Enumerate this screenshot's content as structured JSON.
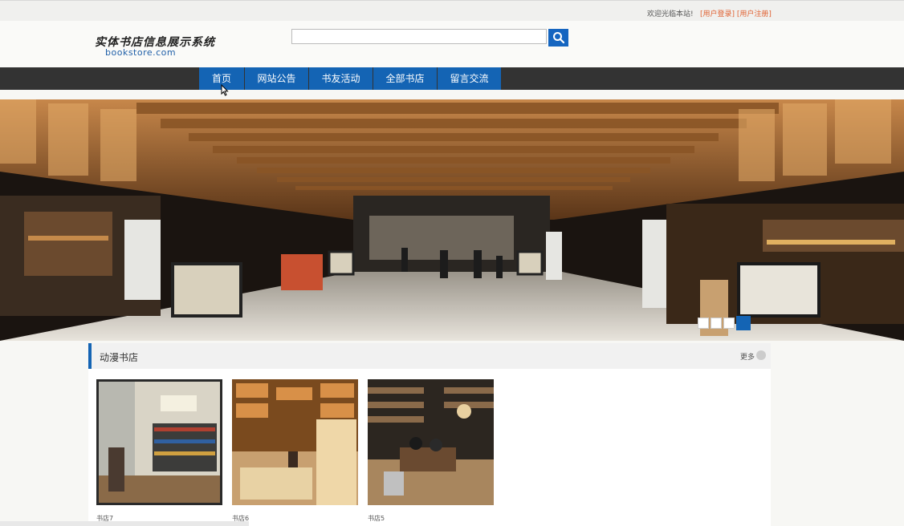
{
  "topbar": {
    "welcome": "欢迎光临本站!",
    "login_link": "[用户登录]",
    "register_link": "[用户注册]"
  },
  "header": {
    "logo_title": "实体书店信息展示系统",
    "logo_domain": "bookstore.com",
    "search": {
      "value": "",
      "placeholder": ""
    },
    "search_icon": "search-icon"
  },
  "nav": {
    "items": [
      {
        "label": "首页"
      },
      {
        "label": "网站公告"
      },
      {
        "label": "书友活动"
      },
      {
        "label": "全部书店"
      },
      {
        "label": "留言交流"
      }
    ]
  },
  "banner": {
    "slide_count": 4,
    "active_slide": 4
  },
  "section": {
    "title": "动漫书店",
    "more": "更多",
    "items": [
      {
        "name": "书店7"
      },
      {
        "name": "书店6"
      },
      {
        "name": "书店5"
      }
    ]
  },
  "colors": {
    "accent": "#1464b4",
    "nav_bg": "#333333",
    "link": "#e06030"
  }
}
